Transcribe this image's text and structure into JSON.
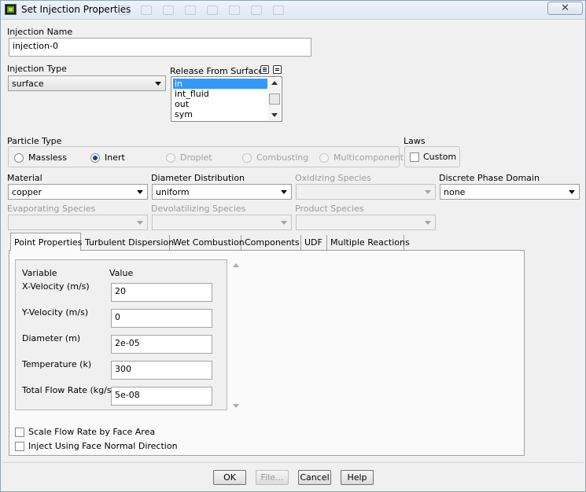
{
  "window": {
    "title": "Set Injection Properties",
    "close_symbol": "✕"
  },
  "injection_name": {
    "label": "Injection Name",
    "value": "injection-0"
  },
  "injection_type": {
    "label": "Injection Type",
    "value": "surface"
  },
  "release_from_surfaces": {
    "label": "Release From Surfaces",
    "items": [
      "in",
      "int_fluid",
      "out",
      "sym"
    ],
    "selected": "in"
  },
  "particle_type": {
    "label": "Particle Type",
    "options": [
      {
        "label": "Massless",
        "checked": false,
        "enabled": true
      },
      {
        "label": "Inert",
        "checked": true,
        "enabled": true
      },
      {
        "label": "Droplet",
        "checked": false,
        "enabled": false
      },
      {
        "label": "Combusting",
        "checked": false,
        "enabled": false
      },
      {
        "label": "Multicomponent",
        "checked": false,
        "enabled": false
      }
    ]
  },
  "laws": {
    "label": "Laws",
    "custom_label": "Custom",
    "custom_checked": false
  },
  "material": {
    "label": "Material",
    "value": "copper"
  },
  "diameter_distribution": {
    "label": "Diameter Distribution",
    "value": "uniform"
  },
  "oxidizing_species": {
    "label": "Oxidizing Species",
    "value": ""
  },
  "discrete_phase_domain": {
    "label": "Discrete Phase Domain",
    "value": "none"
  },
  "evaporating_species": {
    "label": "Evaporating Species",
    "value": ""
  },
  "devolatilizing_species": {
    "label": "Devolatilizing Species",
    "value": ""
  },
  "product_species": {
    "label": "Product Species",
    "value": ""
  },
  "tabs": [
    "Point Properties",
    "Turbulent Dispersion",
    "Wet Combustion",
    "Components",
    "UDF",
    "Multiple Reactions"
  ],
  "active_tab": "Point Properties",
  "point_properties": {
    "col_variable": "Variable",
    "col_value": "Value",
    "rows": [
      {
        "label": "X-Velocity (m/s)",
        "value": "20"
      },
      {
        "label": "Y-Velocity (m/s)",
        "value": "0"
      },
      {
        "label": "Diameter (m)",
        "value": "2e-05"
      },
      {
        "label": "Temperature (k)",
        "value": "300"
      },
      {
        "label": "Total Flow Rate (kg/s)",
        "value": "5e-08"
      }
    ],
    "scale_flow_rate": {
      "label": "Scale Flow Rate by Face Area",
      "checked": false
    },
    "inject_normal": {
      "label": "Inject Using Face Normal Direction",
      "checked": false
    }
  },
  "buttons": {
    "ok": "OK",
    "file": "File...",
    "cancel": "Cancel",
    "help": "Help"
  }
}
